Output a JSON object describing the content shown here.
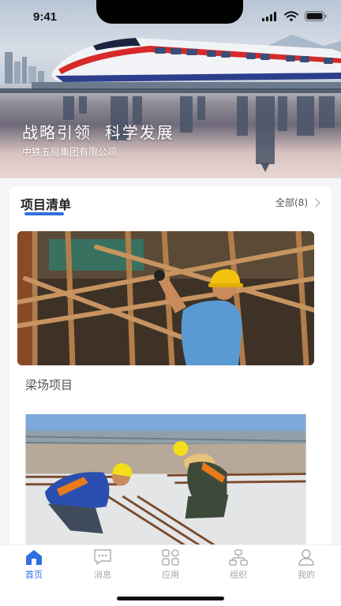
{
  "status_bar": {
    "time": "9:41",
    "icons": [
      "signal-icon",
      "wifi-icon",
      "battery-icon"
    ]
  },
  "hero": {
    "title": "战略引领  科学发展",
    "subtitle": "中铁五局集团有限公司"
  },
  "project_list": {
    "title": "项目清单",
    "view_all_label": "全部(8)",
    "items": [
      {
        "name": "梁场项目"
      },
      {
        "name": ""
      }
    ]
  },
  "tab_bar": {
    "items": [
      {
        "label": "首页",
        "icon": "home-icon",
        "active": true
      },
      {
        "label": "消息",
        "icon": "message-icon",
        "active": false
      },
      {
        "label": "应用",
        "icon": "apps-icon",
        "active": false
      },
      {
        "label": "组织",
        "icon": "organization-icon",
        "active": false
      },
      {
        "label": "我的",
        "icon": "profile-icon",
        "active": false
      }
    ]
  },
  "colors": {
    "accent": "#2f6fe0",
    "inactive_tab": "#a7a7a7",
    "background": "#f4f5f7"
  }
}
